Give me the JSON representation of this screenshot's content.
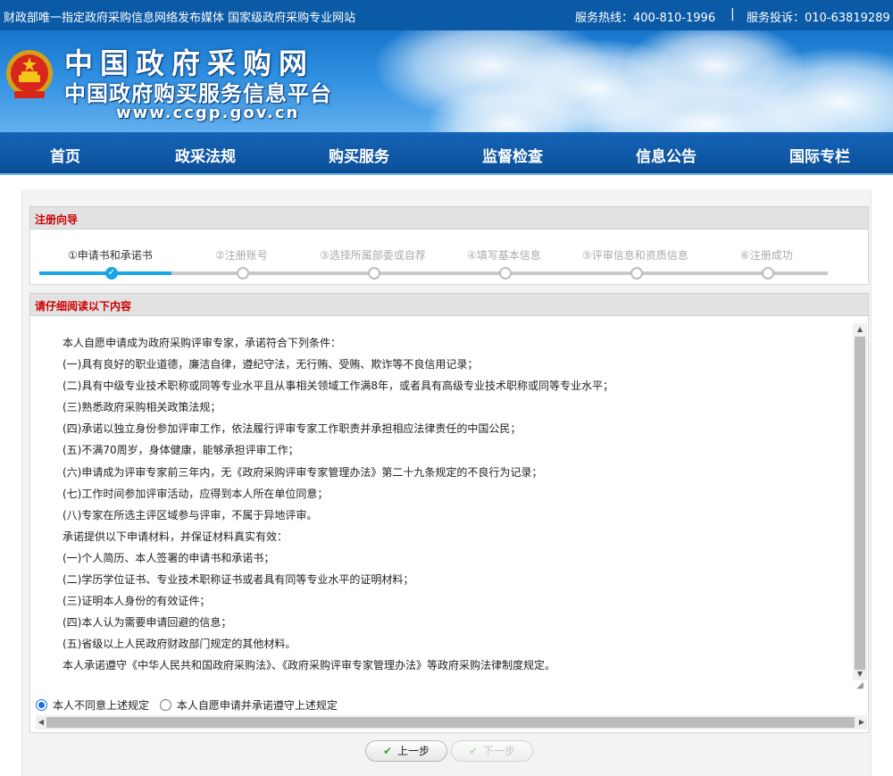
{
  "topbar": {
    "slogan": "财政部唯一指定政府采购信息网络发布媒体 国家级政府采购专业网站",
    "hotline": "服务热线：400-810-1996",
    "separator": "|",
    "complaint": "服务投诉：010-63819289"
  },
  "brand": {
    "title": "中国政府采购网",
    "subtitle": "中国政府购买服务信息平台",
    "url": "www.ccgp.gov.cn"
  },
  "nav": {
    "items": [
      "首页",
      "政采法规",
      "购买服务",
      "监督检查",
      "信息公告",
      "国际专栏"
    ]
  },
  "wizard": {
    "header": "注册向导",
    "steps": [
      "①申请书和承诺书",
      "②注册账号",
      "③选择所属部委或自荐",
      "④填写基本信息",
      "⑤评审信息和资质信息",
      "⑥注册成功"
    ],
    "current_step": 1
  },
  "reading": {
    "header": "请仔细阅读以下内容",
    "lines": [
      "本人自愿申请成为政府采购评审专家，承诺符合下列条件：",
      "(一)具有良好的职业道德，廉洁自律，遵纪守法，无行贿、受贿、欺诈等不良信用记录；",
      "(二)具有中级专业技术职称或同等专业水平且从事相关领域工作满8年，或者具有高级专业技术职称或同等专业水平；",
      "(三)熟悉政府采购相关政策法规；",
      "(四)承诺以独立身份参加评审工作，依法履行评审专家工作职责并承担相应法律责任的中国公民；",
      "(五)不满70周岁，身体健康，能够承担评审工作；",
      "(六)申请成为评审专家前三年内，无《政府采购评审专家管理办法》第二十九条规定的不良行为记录；",
      "(七)工作时间参加评审活动，应得到本人所在单位同意；",
      "(八)专家在所选主评区域参与评审，不属于异地评审。",
      "承诺提供以下申请材料，并保证材料真实有效：",
      "(一)个人简历、本人签署的申请书和承诺书；",
      "(二)学历学位证书、专业技术职称证书或者具有同等专业水平的证明材料；",
      "(三)证明本人身份的有效证件；",
      "(四)本人认为需要申请回避的信息；",
      "(五)省级以上人民政府财政部门规定的其他材料。",
      "本人承诺遵守《中华人民共和国政府采购法》、《政府采购评审专家管理办法》等政府采购法律制度规定。"
    ]
  },
  "agreement": {
    "options": [
      "本人不同意上述规定",
      "本人自愿申请并承诺遵守上述规定"
    ],
    "selected": 0
  },
  "buttons": {
    "prev": "上一步",
    "next": "下一步"
  },
  "colors": {
    "topbar": "#0b5aa6",
    "nav": "#0b4f98",
    "accent": "#1aa6e6",
    "header_text": "#cc0000"
  }
}
